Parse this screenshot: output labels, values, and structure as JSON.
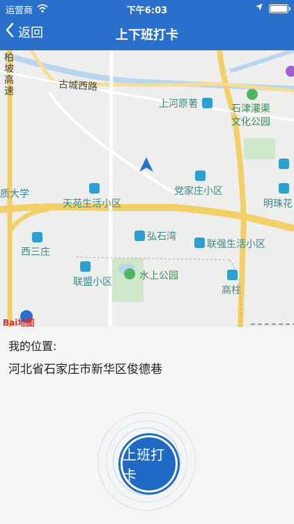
{
  "status": {
    "carrier": "运营商",
    "time": "下午6:03"
  },
  "nav": {
    "back_label": "返回",
    "title": "上下班打卡"
  },
  "map": {
    "labels": {
      "poi_1": "上河原著",
      "poi_2": "石津灌渠",
      "poi_3": "文化公园",
      "poi_4": "古城西路",
      "poi_5": "党家庄小区",
      "poi_6": "天苑生活小区",
      "poi_7": "明珠花",
      "poi_8": "弘石湾",
      "poi_9": "联强生活小区",
      "poi_10": "西三庄",
      "poi_11": "水上公园",
      "poi_12": "联盟小区",
      "poi_13": "高柱",
      "poi_14": "质大学",
      "poi_15": "柏",
      "poi_16": "坡",
      "poi_17": "高",
      "poi_18": "速",
      "logo": "Bai地图"
    }
  },
  "info": {
    "location_label": "我的位置:",
    "address": "河北省石家庄市新华区俊德巷"
  },
  "clock_button_label": "上班打卡"
}
